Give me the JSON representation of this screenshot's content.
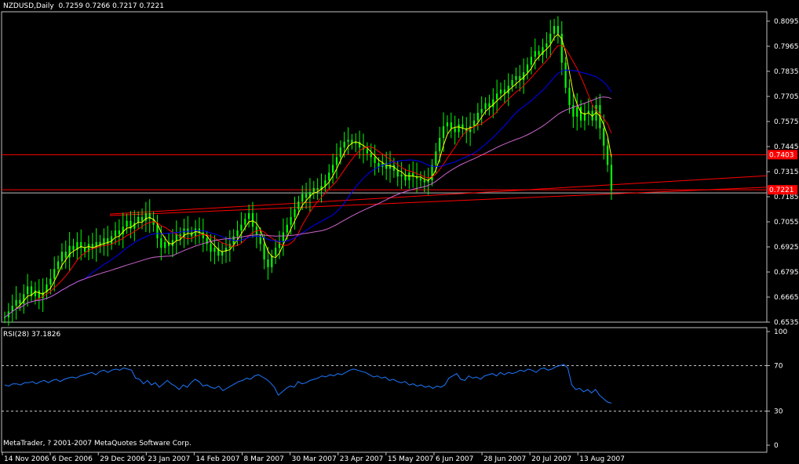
{
  "chart_data": [
    {
      "type": "candlestick",
      "title": "NZDUSD,Daily",
      "ohlc_text": "0.7259 0.7266 0.7217 0.7221",
      "ylim": [
        0.6535,
        0.8095
      ],
      "y_ticks": [
        "0.8095",
        "0.7965",
        "0.7835",
        "0.7705",
        "0.7575",
        "0.7445",
        "0.7315",
        "0.7185",
        "0.7055",
        "0.6925",
        "0.6795",
        "0.6665",
        "0.6535"
      ],
      "x_ticks": [
        "14 Nov 2006",
        "6 Dec 2006",
        "29 Dec 2006",
        "23 Jan 2007",
        "14 Feb 2007",
        "8 Mar 2007",
        "30 Mar 2007",
        "23 Apr 2007",
        "15 May 2007",
        "6 Jun 2007",
        "28 Jun 2007",
        "20 Jul 2007",
        "13 Aug 2007"
      ],
      "price_badges": [
        {
          "label": "0.7403",
          "value": 0.7403,
          "color": "#ff0000"
        },
        {
          "label": "0.7221",
          "value": 0.7221,
          "color": "#ff0000"
        }
      ],
      "horizontal_lines": [
        {
          "value": 0.7403,
          "color": "#ff0000"
        },
        {
          "value": 0.7221,
          "color": "#ff0000"
        },
        {
          "value": 0.7205,
          "color": "#c0c0c0"
        }
      ],
      "close_estimates": [
        0.656,
        0.659,
        0.662,
        0.665,
        0.663,
        0.668,
        0.672,
        0.667,
        0.67,
        0.666,
        0.669,
        0.673,
        0.676,
        0.681,
        0.685,
        0.69,
        0.687,
        0.693,
        0.691,
        0.695,
        0.692,
        0.69,
        0.694,
        0.692,
        0.695,
        0.693,
        0.697,
        0.694,
        0.698,
        0.701,
        0.699,
        0.703,
        0.706,
        0.702,
        0.705,
        0.708,
        0.706,
        0.71,
        0.707,
        0.704,
        0.697,
        0.692,
        0.695,
        0.693,
        0.696,
        0.699,
        0.697,
        0.702,
        0.7,
        0.698,
        0.702,
        0.7,
        0.697,
        0.694,
        0.69,
        0.692,
        0.688,
        0.69,
        0.692,
        0.694,
        0.698,
        0.701,
        0.704,
        0.707,
        0.71,
        0.703,
        0.699,
        0.694,
        0.686,
        0.682,
        0.688,
        0.692,
        0.695,
        0.7,
        0.704,
        0.708,
        0.712,
        0.716,
        0.72,
        0.718,
        0.721,
        0.723,
        0.722,
        0.724,
        0.727,
        0.731,
        0.735,
        0.739,
        0.744,
        0.747,
        0.748,
        0.746,
        0.747,
        0.744,
        0.743,
        0.741,
        0.739,
        0.736,
        0.734,
        0.736,
        0.733,
        0.735,
        0.732,
        0.729,
        0.73,
        0.727,
        0.731,
        0.729,
        0.728,
        0.727,
        0.726,
        0.727,
        0.735,
        0.742,
        0.749,
        0.755,
        0.757,
        0.754,
        0.752,
        0.756,
        0.754,
        0.752,
        0.755,
        0.758,
        0.762,
        0.764,
        0.767,
        0.765,
        0.769,
        0.772,
        0.774,
        0.772,
        0.776,
        0.779,
        0.781,
        0.779,
        0.783,
        0.787,
        0.791,
        0.794,
        0.792,
        0.796,
        0.798,
        0.803,
        0.807,
        0.803,
        0.788,
        0.775,
        0.766,
        0.76,
        0.765,
        0.758,
        0.762,
        0.763,
        0.758,
        0.766,
        0.754,
        0.745,
        0.735,
        0.722
      ]
    },
    {
      "type": "line",
      "title": "RSI(28) 37.1826",
      "ylim": [
        0,
        100
      ],
      "y_ticks": [
        "100",
        "70",
        "30",
        "0"
      ],
      "levels": [
        70,
        30
      ],
      "values": [
        53,
        52,
        54,
        54,
        53,
        55,
        55,
        56,
        54,
        56,
        57,
        55,
        57,
        58,
        56,
        58,
        59,
        60,
        59,
        61,
        62,
        63,
        64,
        62,
        65,
        66,
        64,
        66,
        67,
        66,
        68,
        67,
        66,
        59,
        58,
        54,
        57,
        53,
        55,
        51,
        54,
        57,
        54,
        52,
        49,
        53,
        51,
        55,
        58,
        56,
        52,
        53,
        51,
        50,
        52,
        48,
        50,
        52,
        54,
        56,
        57,
        59,
        58,
        61,
        62,
        60,
        58,
        55,
        51,
        44,
        47,
        50,
        52,
        51,
        56,
        54,
        55,
        57,
        58,
        59,
        61,
        60,
        62,
        61,
        63,
        62,
        64,
        66,
        67,
        66,
        65,
        64,
        62,
        60,
        61,
        59,
        60,
        57,
        58,
        56,
        55,
        56,
        53,
        54,
        52,
        53,
        51,
        52,
        50,
        52,
        51,
        53,
        59,
        61,
        63,
        58,
        57,
        61,
        59,
        60,
        58,
        61,
        62,
        63,
        61,
        64,
        62,
        64,
        63,
        64,
        66,
        65,
        67,
        66,
        64,
        67,
        68,
        66,
        67,
        69,
        70,
        71,
        68,
        53,
        49,
        50,
        47,
        49,
        46,
        49,
        44,
        41,
        38,
        37
      ]
    }
  ],
  "footer": {
    "copyright": "MetaTrader, ? 2001-2007 MetaQuotes Software Corp."
  },
  "colors": {
    "bull": "#00ff00",
    "bear": "#00ff00",
    "ma_fast": "#ffff00",
    "ma_mid": "#ff0000",
    "ma_slow": "#0000ff",
    "ma_slowest": "#cc66cc",
    "trendline": "#ff0000",
    "rsi": "#1e78ff",
    "frame": "#c0c0c0"
  }
}
